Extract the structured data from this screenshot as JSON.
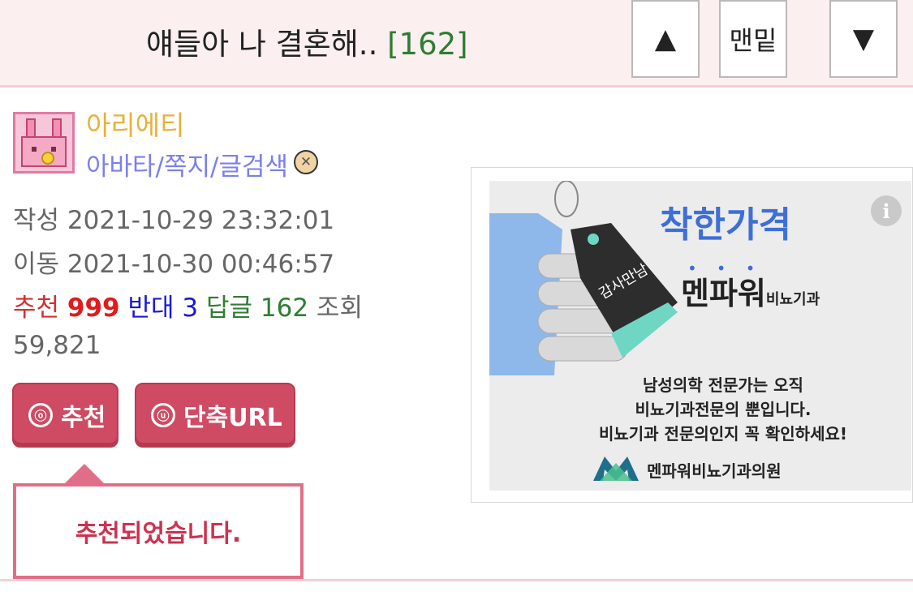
{
  "header": {
    "title": "얘들아 나 결혼해..",
    "reply_count": "[162]",
    "btn_up": "▲",
    "btn_bottom": "맨밑",
    "btn_down": "▼"
  },
  "author": {
    "name": "아리에티",
    "links": "아바타/쪽지/글검색"
  },
  "meta": {
    "written_label": "작성",
    "written_value": "2021-10-29 23:32:01",
    "moved_label": "이동",
    "moved_value": "2021-10-30 00:46:57",
    "recommend_label": "추천",
    "recommend_value": "999",
    "oppose_label": "반대",
    "oppose_value": "3",
    "reply_label": "답글",
    "reply_value": "162",
    "views_label": "조회",
    "views_value": "59,821"
  },
  "actions": {
    "recommend_icon": "ⓞ",
    "recommend_label": "추천",
    "url_icon": "ⓤ",
    "url_label": "단축URL"
  },
  "toast": {
    "message": "추천되었습니다."
  },
  "ad": {
    "info_icon": "i",
    "headline": "착한가격",
    "brand": "멘파워",
    "brand_sub": "비뇨기과",
    "tag_text": "감사만남",
    "line1": "남성의학 전문가는 오직",
    "line2": "비뇨기과전문의 뿐입니다.",
    "line3": "비뇨기과 전문의인지 꼭 확인하세요!",
    "logo_text": "멘파워비뇨기과의원"
  },
  "colors": {
    "header_bg": "#fbefef",
    "accent_pink": "#cf4b63",
    "reply_green": "#2e7d32",
    "recommend_red": "#e01b1b",
    "oppose_blue": "#1818d8",
    "author_gold": "#e8b13a",
    "link_purple": "#7b7ff0"
  }
}
